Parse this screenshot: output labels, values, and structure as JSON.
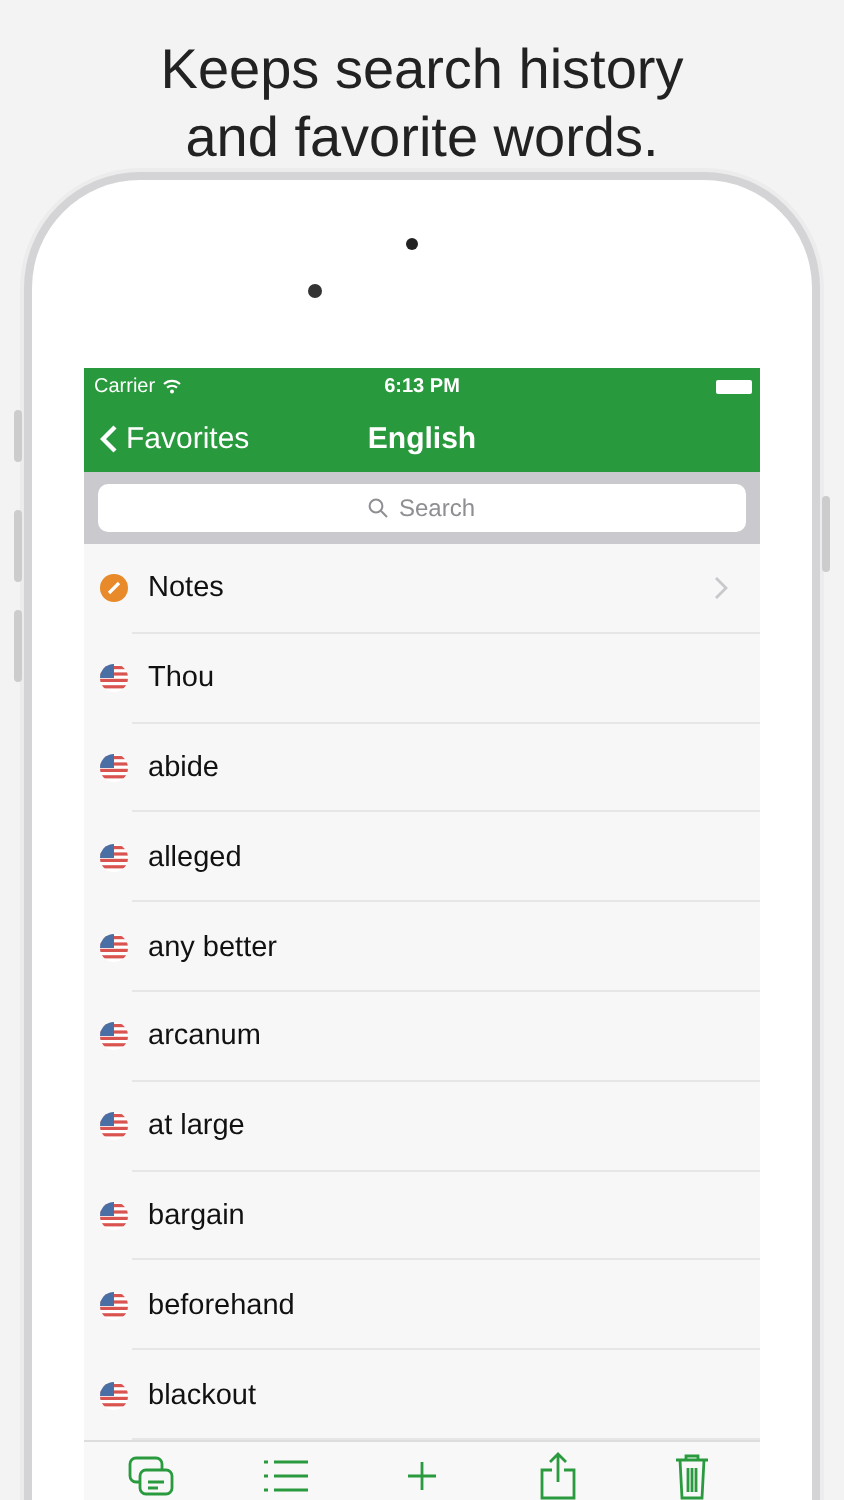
{
  "headline": [
    "Keeps search history",
    "and favorite words."
  ],
  "status_bar": {
    "carrier": "Carrier",
    "time": "6:13 PM"
  },
  "nav": {
    "back": "Favorites",
    "title": "English"
  },
  "search": {
    "placeholder": "Search"
  },
  "rows": [
    {
      "kind": "notes",
      "label": "Notes"
    },
    {
      "kind": "word",
      "label": "Thou"
    },
    {
      "kind": "word",
      "label": "abide"
    },
    {
      "kind": "word",
      "label": "alleged"
    },
    {
      "kind": "word",
      "label": "any better"
    },
    {
      "kind": "word",
      "label": "arcanum"
    },
    {
      "kind": "word",
      "label": "at large"
    },
    {
      "kind": "word",
      "label": "bargain"
    },
    {
      "kind": "word",
      "label": "beforehand"
    },
    {
      "kind": "word",
      "label": "blackout"
    }
  ],
  "toolbar": [
    {
      "kind": "cards"
    },
    {
      "kind": "list"
    },
    {
      "kind": "add"
    },
    {
      "kind": "share"
    },
    {
      "kind": "trash"
    }
  ]
}
